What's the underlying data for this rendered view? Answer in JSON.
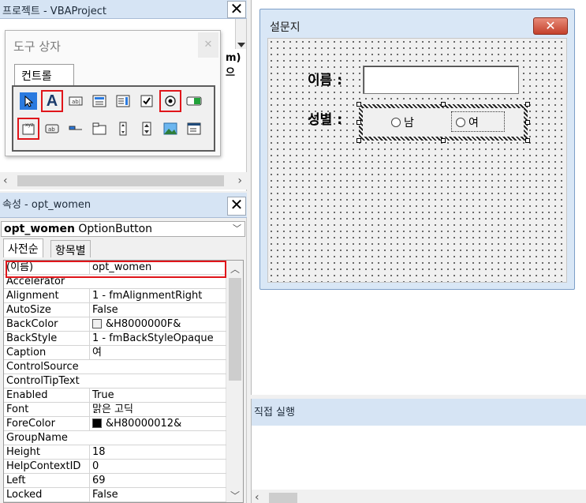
{
  "project_pane": {
    "title": "프로젝트 - VBAProject",
    "close_label": "✕",
    "code_snippet": "m)으"
  },
  "toolbox": {
    "title": "도구 상자",
    "close_label": "✕",
    "tab_label": "컨트롤",
    "tools": [
      {
        "icon": "select-objects-icon",
        "selected": true,
        "highlighted": false
      },
      {
        "icon": "label-icon",
        "selected": false,
        "highlighted": true
      },
      {
        "icon": "textbox-icon",
        "selected": false,
        "highlighted": false
      },
      {
        "icon": "combobox-icon",
        "selected": false,
        "highlighted": false
      },
      {
        "icon": "listbox-icon",
        "selected": false,
        "highlighted": false
      },
      {
        "icon": "checkbox-icon",
        "selected": false,
        "highlighted": false
      },
      {
        "icon": "optionbutton-icon",
        "selected": false,
        "highlighted": true
      },
      {
        "icon": "togglebutton-icon",
        "selected": false,
        "highlighted": false
      },
      {
        "icon": "frame-icon",
        "selected": false,
        "highlighted": true
      },
      {
        "icon": "commandbutton-icon",
        "selected": false,
        "highlighted": false
      },
      {
        "icon": "tabstrip-icon",
        "selected": false,
        "highlighted": false
      },
      {
        "icon": "multipage-icon",
        "selected": false,
        "highlighted": false
      },
      {
        "icon": "scrollbar-icon",
        "selected": false,
        "highlighted": false
      },
      {
        "icon": "spinbutton-icon",
        "selected": false,
        "highlighted": false
      },
      {
        "icon": "image-icon",
        "selected": false,
        "highlighted": false
      },
      {
        "icon": "refedit-icon",
        "selected": false,
        "highlighted": false
      }
    ]
  },
  "properties": {
    "title": "속성 - opt_women",
    "close_label": "✕",
    "object_name": "opt_women",
    "object_type": "OptionButton",
    "tabs": [
      "사전순",
      "항목별"
    ],
    "rows": [
      {
        "name": "(이름)",
        "value": "opt_women"
      },
      {
        "name": "Accelerator",
        "value": ""
      },
      {
        "name": "Alignment",
        "value": "1 - fmAlignmentRight"
      },
      {
        "name": "AutoSize",
        "value": "False"
      },
      {
        "name": "BackColor",
        "value": "&H8000000F&",
        "swatch": "#f0f0f0"
      },
      {
        "name": "BackStyle",
        "value": "1 - fmBackStyleOpaque"
      },
      {
        "name": "Caption",
        "value": "여"
      },
      {
        "name": "ControlSource",
        "value": ""
      },
      {
        "name": "ControlTipText",
        "value": ""
      },
      {
        "name": "Enabled",
        "value": "True"
      },
      {
        "name": "Font",
        "value": "맑은 고딕"
      },
      {
        "name": "ForeColor",
        "value": "&H80000012&",
        "swatch": "#000000"
      },
      {
        "name": "GroupName",
        "value": ""
      },
      {
        "name": "Height",
        "value": "18"
      },
      {
        "name": "HelpContextID",
        "value": "0"
      },
      {
        "name": "Left",
        "value": "69"
      },
      {
        "name": "Locked",
        "value": "False"
      }
    ]
  },
  "userform": {
    "title": "설문지",
    "close_label": "✕",
    "name_label": "이름 :",
    "name_value": "",
    "gender_label": "성별 :",
    "option_male": "남",
    "option_female": "여"
  },
  "immediate": {
    "title": "직접 실행"
  },
  "colors": {
    "highlight": "#e0151a",
    "titlebar": "#d6e4f4",
    "selected_tool": "#2a7adf"
  }
}
